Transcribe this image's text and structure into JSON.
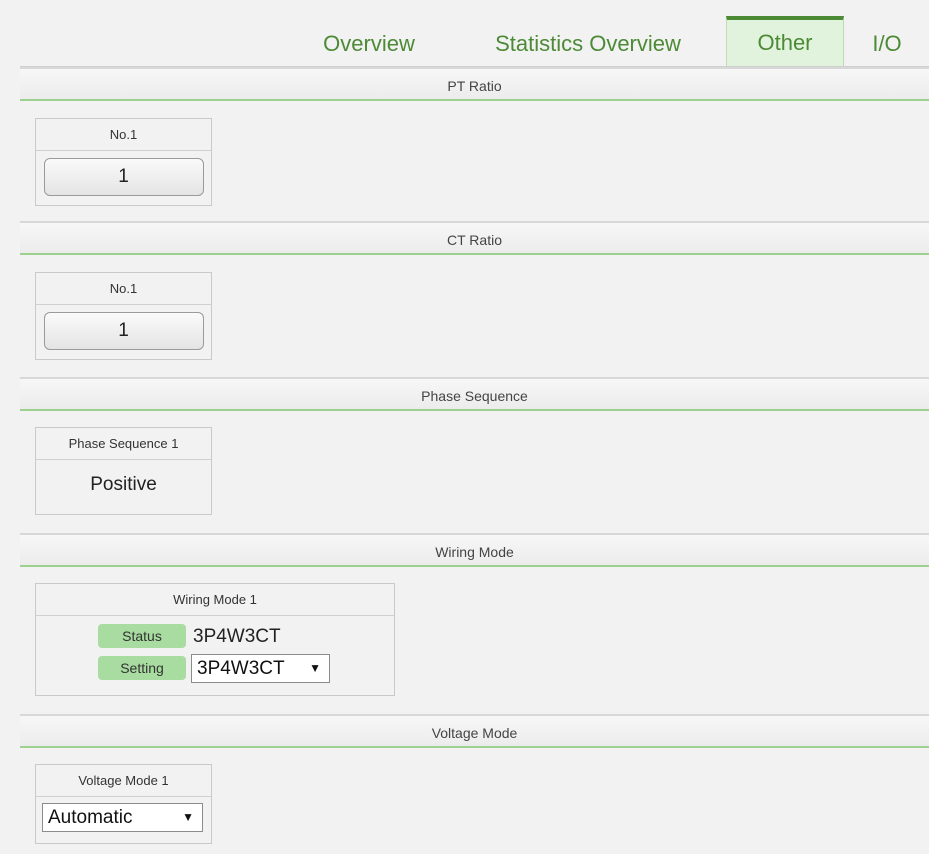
{
  "tabs": {
    "overview": "Overview",
    "statistics": "Statistics Overview",
    "other": "Other",
    "io": "I/O"
  },
  "pt_ratio": {
    "title": "PT Ratio",
    "channel": "No.1",
    "value": "1"
  },
  "ct_ratio": {
    "title": "CT Ratio",
    "channel": "No.1",
    "value": "1"
  },
  "phase_sequence": {
    "title": "Phase Sequence",
    "channel": "Phase Sequence 1",
    "value": "Positive"
  },
  "wiring_mode": {
    "title": "Wiring Mode",
    "channel": "Wiring Mode 1",
    "status_label": "Status",
    "status_value": "3P4W3CT",
    "setting_label": "Setting",
    "setting_value": "3P4W3CT"
  },
  "voltage_mode": {
    "title": "Voltage Mode",
    "channel": "Voltage Mode 1",
    "value": "Automatic"
  },
  "colors": {
    "accent": "#4c8a36",
    "tab_active_bg": "#e1f3dc",
    "pill": "#a8dca0",
    "section_rule": "#9cd190"
  },
  "icons": {
    "dropdown": "caret-down-icon"
  }
}
